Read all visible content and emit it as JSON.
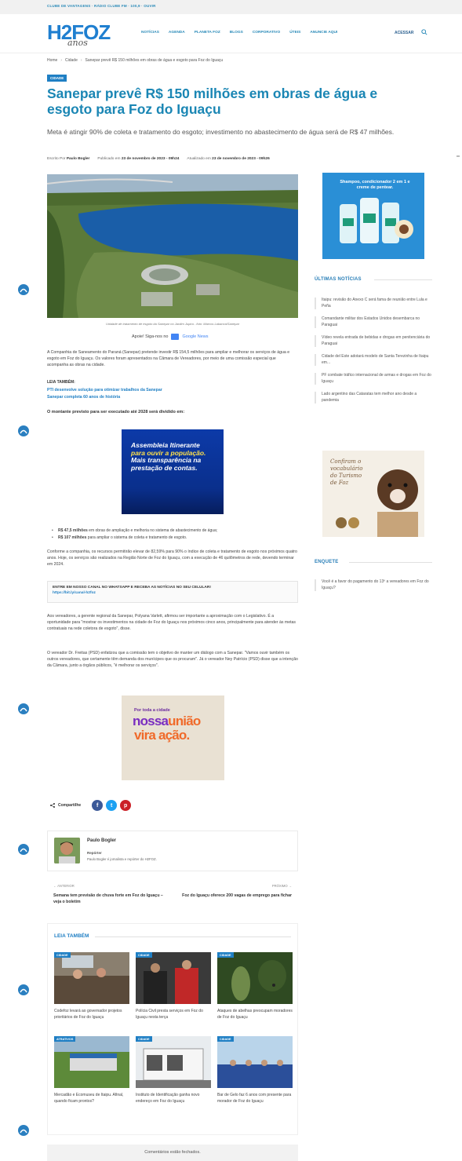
{
  "topbar": {
    "text": "CLUBE DE VANTAGENS · RÁDIO CLUBE FM · 100,9 · OUVIR"
  },
  "header": {
    "logo_text": "H2FOZ",
    "logo_sub": "anos",
    "nav": [
      "NOTÍCIAS",
      "AGENDA",
      "PLANETA FOZ",
      "BLOGS",
      "CORPORATIVO",
      "ÚTEIS",
      "ANUNCIE AQUI"
    ],
    "login_label": "ACESSAR"
  },
  "breadcrumb": {
    "home": "Home",
    "section": "Cidade",
    "current": "Sanepar prevê R$ 150 milhões em obras de água e esgoto para Foz do Iguaçu"
  },
  "article": {
    "category": "CIDADE",
    "title": "Sanepar prevê R$ 150 milhões em obras de água e esgoto para Foz do Iguaçu",
    "subtitle": "Meta é atingir 90% de coleta e tratamento do esgoto; investimento no abastecimento de água será de R$ 47 milhões.",
    "meta": {
      "author_prefix": "Escrito Por",
      "author": "Paulo Bogler",
      "published_label": "Publicado em",
      "published": "23 de novembro de 2023 - 09h24",
      "updated_label": "Atualizado em",
      "updated": "23 de novembro de 2023 - 09h26"
    },
    "image_caption": "Unidade de tratamento de esgoto da Sanepar no Jardim Jupira - foto: Marcos Labanca/Sanepar",
    "gnews_prefix": "Apoie! Siga-nos no",
    "gnews_label": "Google News",
    "p1": "A Companhia de Saneamento do Paraná (Sanepar) pretende investir R$ 154,5 milhões para ampliar e melhorar os serviços de água e esgoto em Foz do Iguaçu. Os valores foram apresentados na Câmara de Vereadores, por meio de uma comissão especial que acompanha as obras na cidade.",
    "leia_label": "LEIA TAMBÉM:",
    "leia_links": [
      "PTI desenvolve solução para otimizar trabalhos da Sanepar",
      "Sanepar completa 60 anos de história"
    ],
    "bold_line": "O montante previsto para ser executado até 2028 será dividido em:",
    "bullets": [
      {
        "bold": "R$ 47,5 milhões",
        "text": " em obras de ampliação e melhoria no sistema de abastecimento de água;"
      },
      {
        "bold": "R$ 107 milhões",
        "text": " para ampliar o sistema de coleta e tratamento de esgoto."
      }
    ],
    "p2": "Conforme a companhia, os recursos permitirão elevar de 82,59% para 90% o índice de coleta e tratamento de esgoto nos próximos quatro anos. Hoje, os serviços são realizados na Região Norte de Foz do Iguaçu, com a execução de 46 quilômetros de rede, devendo terminar em 2024.",
    "whatsapp_line1": "ENTRE EM NOSSO CANAL NO WHATSAPP E RECEBA AS NOTÍCIAS NO SEU CELULAR!",
    "whatsapp_line2": "https://bit.ly/canal-h2foz",
    "p3": "Aos vereadores, a gerente regional da Sanepar, Polyana Varlett, afirmou ser importante a aproximação com o Legislativo. É a oportunidade para \"mostrar os investimentos na cidade de Foz do Iguaçu nos próximos cinco anos, principalmente para atender às metas contratuais na rede coletora de esgoto\", disse.",
    "p4": "O vereador Dr. Freitas (PSD) enfatizou que a comissão tem o objetivo de manter um diálogo com a Sanepar. \"Vamos ouvir também os outros vereadores, que certamente têm demanda dos munícipes que os procuram\". Já o vereador Ney Patrício (PSD) disse que a intenção da Câmara, junto a órgãos públicos, \"é melhorar os serviços\"."
  },
  "ads": {
    "ad1_line1": "Assembleia Itinerante",
    "ad1_line2": "para ouvir a população.",
    "ad1_line3": "Mais transparência na",
    "ad1_line4": "prestação de contas.",
    "ad2_small": "Por toda a cidade",
    "ad2_big1a": "nossa",
    "ad2_big1b": "união",
    "ad2_big2": "vira ação.",
    "side1": "Shampoo, condicionador 2 em 1 e creme de pentear.",
    "side2": "Confiram o vocabulário do Turismo de Foz"
  },
  "share": {
    "label": "Compartilhe",
    "colors": {
      "facebook": "#3b5998",
      "twitter": "#1da1f2",
      "pinterest": "#cb2027"
    }
  },
  "author_box": {
    "name": "Paulo Bogler",
    "role": "Repórter",
    "bio": "Paulo Bogler é jornalista e repórter do H2FOZ."
  },
  "prev_next": {
    "prev_label": "ANTERIOR",
    "prev_title": "Semana tem previsão de chuva forte em Foz do Iguaçu – veja o boletim",
    "next_label": "PRÓXIMO",
    "next_title": "Foz do Iguaçu oferece 200 vagas de emprego para fichar"
  },
  "related": {
    "heading": "LEIA TAMBÉM",
    "items": [
      {
        "badge": "CIDADE",
        "title": "Codefoz levará ao governador projetos prioritários de Foz do Iguaçu"
      },
      {
        "badge": "CIDADE",
        "title": "Polícia Civil presta serviços em Foz do Iguaçu nesta terça"
      },
      {
        "badge": "CIDADE",
        "title": "Ataques de abelhas preocupam moradores de Foz do Iguaçu"
      },
      {
        "badge": "ATRATIVOS",
        "title": "Mercadão e Ecomuseu de Itaipu. Afinal, quando ficam prontos?"
      },
      {
        "badge": "CIDADE",
        "title": "Instituto de Identificação ganha novo endereço em Foz do Iguaçu"
      },
      {
        "badge": "CIDADE",
        "title": "Bar de Gelo faz 6 anos com presente para morador de Foz do Iguaçu"
      }
    ]
  },
  "comments": "Comentários estão fechados.",
  "sidebar": {
    "latest_heading": "ÚLTIMAS NOTÍCIAS",
    "latest": [
      "Itaipu: revisão do Anexo C será fama de reunião entre Lula e Peña",
      "Comandante militar dos Estados Unidos desembarca no Paraguai",
      "Vídeo revela entrada de bebidas e drogas em penitenciária do Paraguai",
      "Cidade del Este adotará modelo de Santa Terezinha de Itaipu em...",
      "PF combate tráfico internacional de armas e drogas em Foz do Iguaçu",
      "Lado argentino das Cataratas tem melhor ano desde a pandemia"
    ],
    "poll_heading": "ENQUETE",
    "poll": "Você é a favor do pagamento do 13º a vereadores em Foz do Iguaçu?"
  }
}
